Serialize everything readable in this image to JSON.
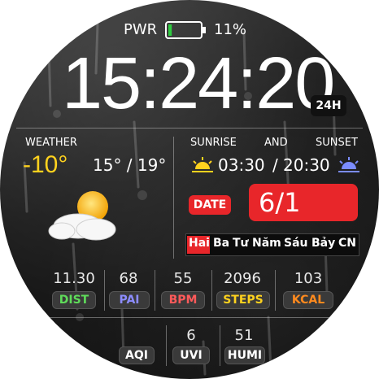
{
  "status": {
    "pwr_label": "PWR",
    "battery": "11%",
    "battery_level": 0.11
  },
  "time": {
    "value": "15:24:20",
    "format": "24H"
  },
  "weather": {
    "label": "WEATHER",
    "temp": "-10°",
    "range": "15° / 19°",
    "icon": "partly-cloudy-sun-icon"
  },
  "sun": {
    "sunrise_label": "SUNRISE",
    "and_label": "AND",
    "sunset_label": "SUNSET",
    "sunrise_time": "03:30",
    "slash": "/",
    "sunset_time": "20:30"
  },
  "date": {
    "label": "DATE",
    "value": "6/1"
  },
  "weekdays": [
    "Hai",
    "Ba",
    "Tư",
    "Năm",
    "Sáu",
    "Bảy",
    "CN"
  ],
  "stats": [
    {
      "value": "11.30",
      "label": "DIST",
      "color": "#5fdc5a"
    },
    {
      "value": "68",
      "label": "PAI",
      "color": "#8c8cff"
    },
    {
      "value": "55",
      "label": "BPM",
      "color": "#ff5a5a"
    },
    {
      "value": "2096",
      "label": "STEPS",
      "color": "#ffd21e"
    },
    {
      "value": "103",
      "label": "KCAL",
      "color": "#ff8a1e"
    }
  ],
  "env": [
    {
      "value": "",
      "label": "AQI"
    },
    {
      "value": "6",
      "label": "UVI"
    },
    {
      "value": "51",
      "label": "HUMI"
    }
  ],
  "colors": {
    "accent_red": "#e8262a",
    "temp_yellow": "#ffd21e",
    "battery_green": "#2ecc40"
  }
}
